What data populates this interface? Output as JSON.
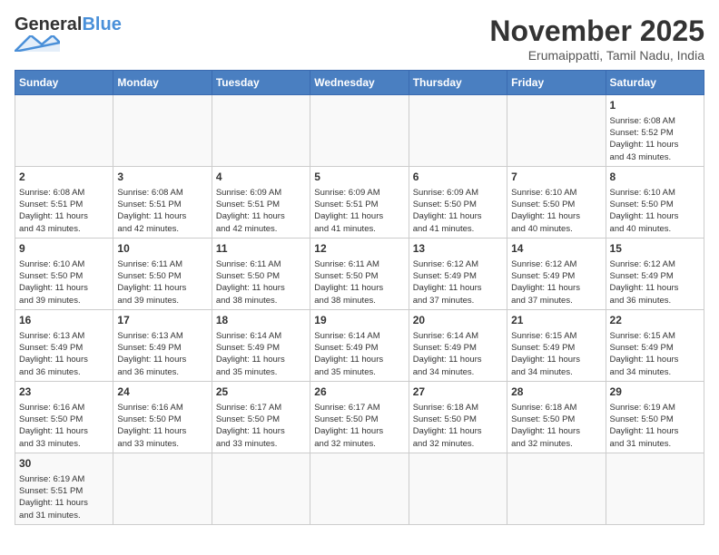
{
  "header": {
    "logo_general": "General",
    "logo_blue": "Blue",
    "month_title": "November 2025",
    "location": "Erumaippatti, Tamil Nadu, India"
  },
  "weekdays": [
    "Sunday",
    "Monday",
    "Tuesday",
    "Wednesday",
    "Thursday",
    "Friday",
    "Saturday"
  ],
  "weeks": [
    [
      {
        "day": "",
        "info": ""
      },
      {
        "day": "",
        "info": ""
      },
      {
        "day": "",
        "info": ""
      },
      {
        "day": "",
        "info": ""
      },
      {
        "day": "",
        "info": ""
      },
      {
        "day": "",
        "info": ""
      },
      {
        "day": "1",
        "info": "Sunrise: 6:08 AM\nSunset: 5:52 PM\nDaylight: 11 hours\nand 43 minutes."
      }
    ],
    [
      {
        "day": "2",
        "info": "Sunrise: 6:08 AM\nSunset: 5:51 PM\nDaylight: 11 hours\nand 43 minutes."
      },
      {
        "day": "3",
        "info": "Sunrise: 6:08 AM\nSunset: 5:51 PM\nDaylight: 11 hours\nand 42 minutes."
      },
      {
        "day": "4",
        "info": "Sunrise: 6:09 AM\nSunset: 5:51 PM\nDaylight: 11 hours\nand 42 minutes."
      },
      {
        "day": "5",
        "info": "Sunrise: 6:09 AM\nSunset: 5:51 PM\nDaylight: 11 hours\nand 41 minutes."
      },
      {
        "day": "6",
        "info": "Sunrise: 6:09 AM\nSunset: 5:50 PM\nDaylight: 11 hours\nand 41 minutes."
      },
      {
        "day": "7",
        "info": "Sunrise: 6:10 AM\nSunset: 5:50 PM\nDaylight: 11 hours\nand 40 minutes."
      },
      {
        "day": "8",
        "info": "Sunrise: 6:10 AM\nSunset: 5:50 PM\nDaylight: 11 hours\nand 40 minutes."
      }
    ],
    [
      {
        "day": "9",
        "info": "Sunrise: 6:10 AM\nSunset: 5:50 PM\nDaylight: 11 hours\nand 39 minutes."
      },
      {
        "day": "10",
        "info": "Sunrise: 6:11 AM\nSunset: 5:50 PM\nDaylight: 11 hours\nand 39 minutes."
      },
      {
        "day": "11",
        "info": "Sunrise: 6:11 AM\nSunset: 5:50 PM\nDaylight: 11 hours\nand 38 minutes."
      },
      {
        "day": "12",
        "info": "Sunrise: 6:11 AM\nSunset: 5:50 PM\nDaylight: 11 hours\nand 38 minutes."
      },
      {
        "day": "13",
        "info": "Sunrise: 6:12 AM\nSunset: 5:49 PM\nDaylight: 11 hours\nand 37 minutes."
      },
      {
        "day": "14",
        "info": "Sunrise: 6:12 AM\nSunset: 5:49 PM\nDaylight: 11 hours\nand 37 minutes."
      },
      {
        "day": "15",
        "info": "Sunrise: 6:12 AM\nSunset: 5:49 PM\nDaylight: 11 hours\nand 36 minutes."
      }
    ],
    [
      {
        "day": "16",
        "info": "Sunrise: 6:13 AM\nSunset: 5:49 PM\nDaylight: 11 hours\nand 36 minutes."
      },
      {
        "day": "17",
        "info": "Sunrise: 6:13 AM\nSunset: 5:49 PM\nDaylight: 11 hours\nand 36 minutes."
      },
      {
        "day": "18",
        "info": "Sunrise: 6:14 AM\nSunset: 5:49 PM\nDaylight: 11 hours\nand 35 minutes."
      },
      {
        "day": "19",
        "info": "Sunrise: 6:14 AM\nSunset: 5:49 PM\nDaylight: 11 hours\nand 35 minutes."
      },
      {
        "day": "20",
        "info": "Sunrise: 6:14 AM\nSunset: 5:49 PM\nDaylight: 11 hours\nand 34 minutes."
      },
      {
        "day": "21",
        "info": "Sunrise: 6:15 AM\nSunset: 5:49 PM\nDaylight: 11 hours\nand 34 minutes."
      },
      {
        "day": "22",
        "info": "Sunrise: 6:15 AM\nSunset: 5:49 PM\nDaylight: 11 hours\nand 34 minutes."
      }
    ],
    [
      {
        "day": "23",
        "info": "Sunrise: 6:16 AM\nSunset: 5:50 PM\nDaylight: 11 hours\nand 33 minutes."
      },
      {
        "day": "24",
        "info": "Sunrise: 6:16 AM\nSunset: 5:50 PM\nDaylight: 11 hours\nand 33 minutes."
      },
      {
        "day": "25",
        "info": "Sunrise: 6:17 AM\nSunset: 5:50 PM\nDaylight: 11 hours\nand 33 minutes."
      },
      {
        "day": "26",
        "info": "Sunrise: 6:17 AM\nSunset: 5:50 PM\nDaylight: 11 hours\nand 32 minutes."
      },
      {
        "day": "27",
        "info": "Sunrise: 6:18 AM\nSunset: 5:50 PM\nDaylight: 11 hours\nand 32 minutes."
      },
      {
        "day": "28",
        "info": "Sunrise: 6:18 AM\nSunset: 5:50 PM\nDaylight: 11 hours\nand 32 minutes."
      },
      {
        "day": "29",
        "info": "Sunrise: 6:19 AM\nSunset: 5:50 PM\nDaylight: 11 hours\nand 31 minutes."
      }
    ],
    [
      {
        "day": "30",
        "info": "Sunrise: 6:19 AM\nSunset: 5:51 PM\nDaylight: 11 hours\nand 31 minutes."
      },
      {
        "day": "",
        "info": ""
      },
      {
        "day": "",
        "info": ""
      },
      {
        "day": "",
        "info": ""
      },
      {
        "day": "",
        "info": ""
      },
      {
        "day": "",
        "info": ""
      },
      {
        "day": "",
        "info": ""
      }
    ]
  ]
}
